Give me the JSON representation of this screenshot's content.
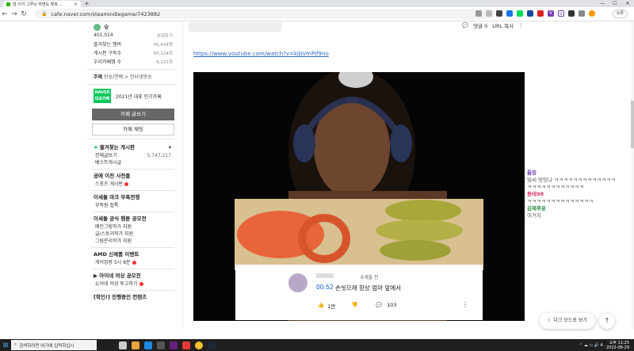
{
  "browser": {
    "tab_title": "형 이거 그루닝 하면도 맞죠 ...",
    "url": "cafe.naver.com/steamindiegame/7423882",
    "profile_label": "오류"
  },
  "sidebar": {
    "cafe_level": "숲",
    "member_count": "401,014",
    "invite_label": "초대하기",
    "stats": [
      {
        "label": "즐겨찾는 멤버",
        "value": "41,434명"
      },
      {
        "label": "게시판 구독수",
        "value": "65,124회"
      },
      {
        "label": "우리카페앱 수",
        "value": "6,221회"
      }
    ],
    "topic_label": "주제",
    "topic_path": "방송/연예 > 인터넷방송",
    "award_badge": "NAVER 대표카페",
    "award_text": "2021년 대표 인기카페",
    "write_button": "카페 글쓰기",
    "chat_button": "카페 채팅",
    "favorites_title": "즐겨찾는 게시판",
    "menus": [
      {
        "title": "",
        "items": [
          {
            "label": "전체글보기",
            "count": "5,747,217"
          },
          {
            "label": "베스트게시글",
            "count": ""
          }
        ]
      },
      {
        "title": "공에 이전 사전들",
        "items": [
          {
            "label": "스포츠 게시판",
            "count": "",
            "new": true
          }
        ]
      },
      {
        "title": "이세돌 마크 부족전쟁",
        "items": [
          {
            "label": "부족원 접톡",
            "count": ""
          }
        ]
      },
      {
        "title": "이세돌 공식 팬툰 공모전",
        "items": [
          {
            "label": "메인그림작가 지원",
            "count": ""
          },
          {
            "label": "글/스토리작가 지원",
            "count": ""
          },
          {
            "label": "그림온리작가 지원",
            "count": ""
          }
        ]
      },
      {
        "title": "AMD 신제품 이벤트",
        "items": [
          {
            "label": "게이밍랑 5시 8분",
            "count": "",
            "new": true
          }
        ]
      },
      {
        "title": "아이네 의상 공모전",
        "items": [
          {
            "label": "뉴이네 의상 투고하기",
            "count": "",
            "new": true
          }
        ]
      },
      {
        "title": "[학인!] 진행중인 컨텐츠",
        "items": []
      }
    ]
  },
  "post": {
    "comment_label": "댓글 0",
    "url_copy_label": "URL 복사",
    "youtube_link": "https://www.youtube.com/watch?v=kjbVmPjf9no"
  },
  "yt_comment": {
    "time": "6개월 전",
    "timestamp": "00:52",
    "text": "손씻으래 항상 엄마 앞에서",
    "likes": "1만",
    "replies": "103"
  },
  "chat": [
    {
      "name": "",
      "text": "",
      "color": "#888888"
    },
    {
      "name": "톱밍",
      "text": "빌씨 맛밌나 ㅋㅋㅋㅋㅋㅋㅋㅋㅋㅋㅋㅋㅋ",
      "color": "#6a3fb5"
    },
    {
      "name": "",
      "text": "ㅋㅋㅋㅋㅋㅋㅋㅋㅋㅋㅋㅋ",
      "color": "#555555"
    },
    {
      "name": "동테98",
      "text": "ㅋㅋㅋㅋㅋㅋㅋㅋㅋㅋㅋㅋㅋㅋ",
      "color": "#d6336c"
    },
    {
      "name": "김제후운",
      "text": "이거지",
      "color": "#2b8a3e"
    }
  ],
  "buttons": {
    "dark_mode": "다크 모드로 보기"
  },
  "taskbar": {
    "search_placeholder": "검색하려면 여기에 입력하십시",
    "time": "오후 11:25",
    "date": "2022-08-29"
  }
}
